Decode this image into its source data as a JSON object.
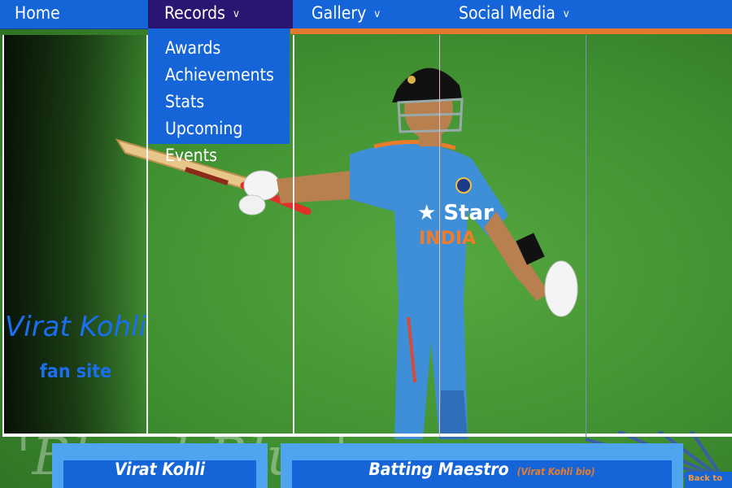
{
  "nav": {
    "home": "Home",
    "records": "Records",
    "gallery": "Gallery",
    "social_media": "Social Media",
    "chevron": "v"
  },
  "records_menu": {
    "items": [
      "Awards",
      "Achievements",
      "Stats",
      "Upcoming Events"
    ]
  },
  "hero": {
    "title": "Virat Kohli",
    "subtitle": "fan site",
    "background_text": "'Bleed Blue'",
    "jersey_text": "Star",
    "jersey_subtext": "INDIA"
  },
  "cards": {
    "left_label": "Virat Kohli",
    "right_label": "Batting Maestro",
    "right_note": "(Virat Kohli bio)"
  },
  "footer": {
    "back_to": "Back to"
  },
  "colors": {
    "nav_blue": "#1565d8",
    "nav_active": "#2a1572",
    "accent_orange": "#e57a2e",
    "title_blue": "#1a6ff0",
    "jersey_blue": "#3f8fd8"
  }
}
